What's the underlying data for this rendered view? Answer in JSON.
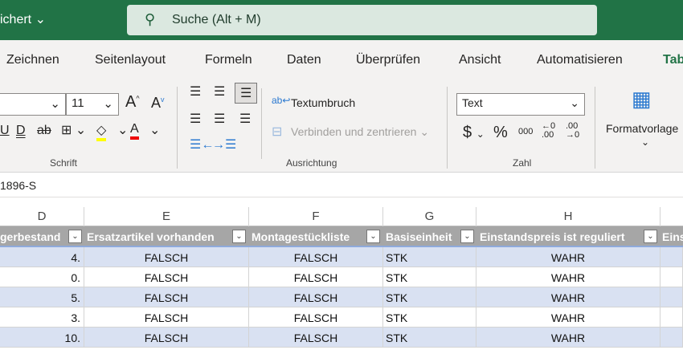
{
  "title": {
    "filename": "ichert",
    "search_placeholder": "Suche (Alt + M)"
  },
  "tabs": [
    "Zeichnen",
    "Seitenlayout",
    "Formeln",
    "Daten",
    "Überprüfen",
    "Ansicht",
    "Automatisieren",
    "Tab"
  ],
  "ribbon": {
    "font_size": "11",
    "wrap_text": "Textumbruch",
    "merge_center": "Verbinden und zentrieren",
    "number_format": "Text",
    "format_templates": "Formatvorlage",
    "groups": {
      "font": "Schrift",
      "alignment": "Ausrichtung",
      "number": "Zahl"
    }
  },
  "formula_bar": {
    "cell_ref": "1896-S"
  },
  "columns": [
    "D",
    "E",
    "F",
    "G",
    "H"
  ],
  "table_headers": [
    "gerbestand",
    "Ersatzartikel vorhanden",
    "Montagestückliste",
    "Basiseinheit",
    "Einstandspreis ist reguliert",
    "Eins"
  ],
  "rows": [
    [
      "4.",
      "FALSCH",
      "FALSCH",
      "STK",
      "WAHR"
    ],
    [
      "0.",
      "FALSCH",
      "FALSCH",
      "STK",
      "WAHR"
    ],
    [
      "5.",
      "FALSCH",
      "FALSCH",
      "STK",
      "WAHR"
    ],
    [
      "3.",
      "FALSCH",
      "FALSCH",
      "STK",
      "WAHR"
    ],
    [
      "10.",
      "FALSCH",
      "FALSCH",
      "STK",
      "WAHR"
    ]
  ]
}
